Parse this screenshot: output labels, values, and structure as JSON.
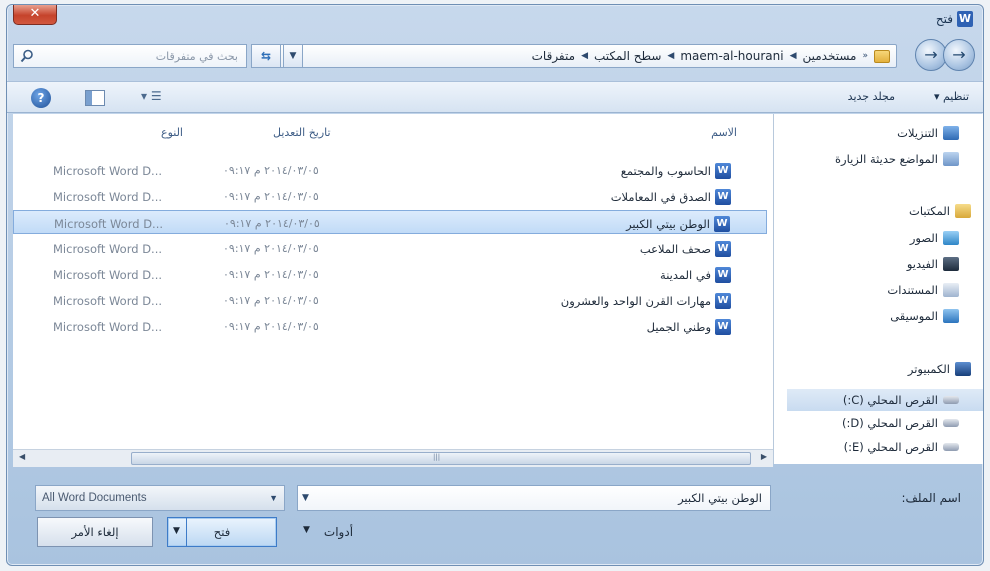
{
  "window": {
    "title": "فتح",
    "app_icon_letter": "W",
    "close_label": "✕"
  },
  "address": {
    "crumbs": [
      "مستخدمين",
      "maem-al-hourani",
      "سطح المكتب",
      "متفرقات"
    ],
    "search_placeholder": "بحث في متفرقات"
  },
  "toolbar": {
    "organize_label": "تنظيم ▾",
    "new_folder_label": "مجلد جديد",
    "views_label": "▾ ☰"
  },
  "nav": {
    "favorites": [
      {
        "label": "التنزيلات",
        "icon": "downloads-icon"
      },
      {
        "label": "المواضع حديثة الزيارة",
        "icon": "recent-places-icon"
      }
    ],
    "libraries_label": "المكتبات",
    "libraries": [
      {
        "label": "الصور",
        "icon": "pictures-icon"
      },
      {
        "label": "الفيديو",
        "icon": "videos-icon"
      },
      {
        "label": "المستندات",
        "icon": "documents-icon"
      },
      {
        "label": "الموسيقى",
        "icon": "music-icon"
      }
    ],
    "computer_label": "الكمبيوتر",
    "drives": [
      {
        "label": "القرص المحلي (C:)",
        "selected": true
      },
      {
        "label": "القرص المحلي (D:)",
        "selected": false
      },
      {
        "label": "القرص المحلي (E:)",
        "selected": false
      }
    ]
  },
  "filelist": {
    "columns": {
      "name": "الاسم",
      "date": "تاريخ التعديل",
      "type": "النوع"
    },
    "rows": [
      {
        "name": "الحاسوب والمجتمع",
        "date": "٢٠١٤/٠٣/٠٥ م ٠٩:١٧",
        "type": "Microsoft Word D...",
        "selected": false
      },
      {
        "name": "الصدق في المعاملات",
        "date": "٢٠١٤/٠٣/٠٥ م ٠٩:١٧",
        "type": "Microsoft Word D...",
        "selected": false
      },
      {
        "name": "الوطن بيتي الكبير",
        "date": "٢٠١٤/٠٣/٠٥ م ٠٩:١٧",
        "type": "Microsoft Word D...",
        "selected": true
      },
      {
        "name": "صحف الملاعب",
        "date": "٢٠١٤/٠٣/٠٥ م ٠٩:١٧",
        "type": "Microsoft Word D...",
        "selected": false
      },
      {
        "name": "في المدينة",
        "date": "٢٠١٤/٠٣/٠٥ م ٠٩:١٧",
        "type": "Microsoft Word D...",
        "selected": false
      },
      {
        "name": "مهارات القرن الواحد والعشرون",
        "date": "٢٠١٤/٠٣/٠٥ م ٠٩:١٧",
        "type": "Microsoft Word D...",
        "selected": false
      },
      {
        "name": "وطني الجميل",
        "date": "٢٠١٤/٠٣/٠٥ م ٠٩:١٧",
        "type": "Microsoft Word D...",
        "selected": false
      }
    ]
  },
  "bottom": {
    "filename_label": "اسم الملف:",
    "filename_value": "الوطن بيتي الكبير",
    "filetype_value": "All Word Documents",
    "tools_label": "أدوات",
    "open_label": "فتح",
    "cancel_label": "إلغاء الأمر"
  },
  "colors": {
    "selection": "#c1dbf7",
    "window_frame": "#b4cbe4",
    "open_button_border": "#3d7bc8"
  }
}
